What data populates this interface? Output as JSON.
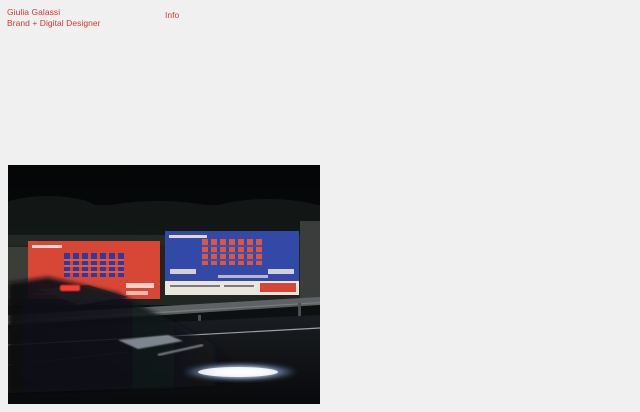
{
  "header": {
    "name": "Giulia Galassi",
    "role": "Brand + Digital Designer",
    "nav_info": "Info"
  },
  "project": {
    "image_alt": "Night photograph of two billboards, one red and one blue, beside a road with light trails from passing traffic"
  },
  "colors": {
    "background": "#f0f0f0",
    "accent": "#d23a2c"
  }
}
